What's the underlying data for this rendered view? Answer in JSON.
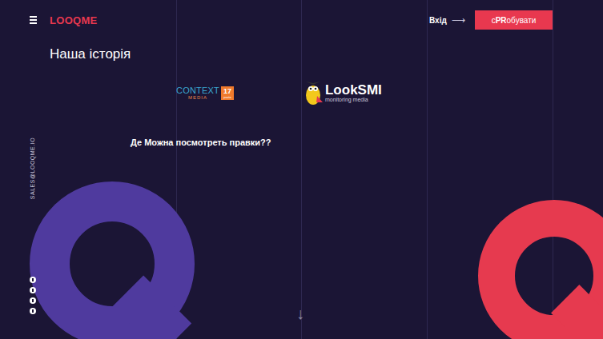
{
  "header": {
    "logo": "LOOQME",
    "login": {
      "label": "Вхід",
      "arrow": "⟶"
    },
    "cta": {
      "before": "с",
      "bold": "PR",
      "after": "обувати"
    }
  },
  "title": "Наша історія",
  "partners": {
    "context": {
      "name": "CONTEXT",
      "sub": "MEDIA",
      "years": "17",
      "years_label": "років"
    },
    "looksmi": {
      "look": "Look",
      "smi": "SMI",
      "tagline": "monitoring media"
    }
  },
  "note": "Де Можна посмотреть правки??",
  "sidebar": {
    "email": "SALES@LOOQME.IO"
  },
  "scroll": {
    "arrow": "↓"
  }
}
